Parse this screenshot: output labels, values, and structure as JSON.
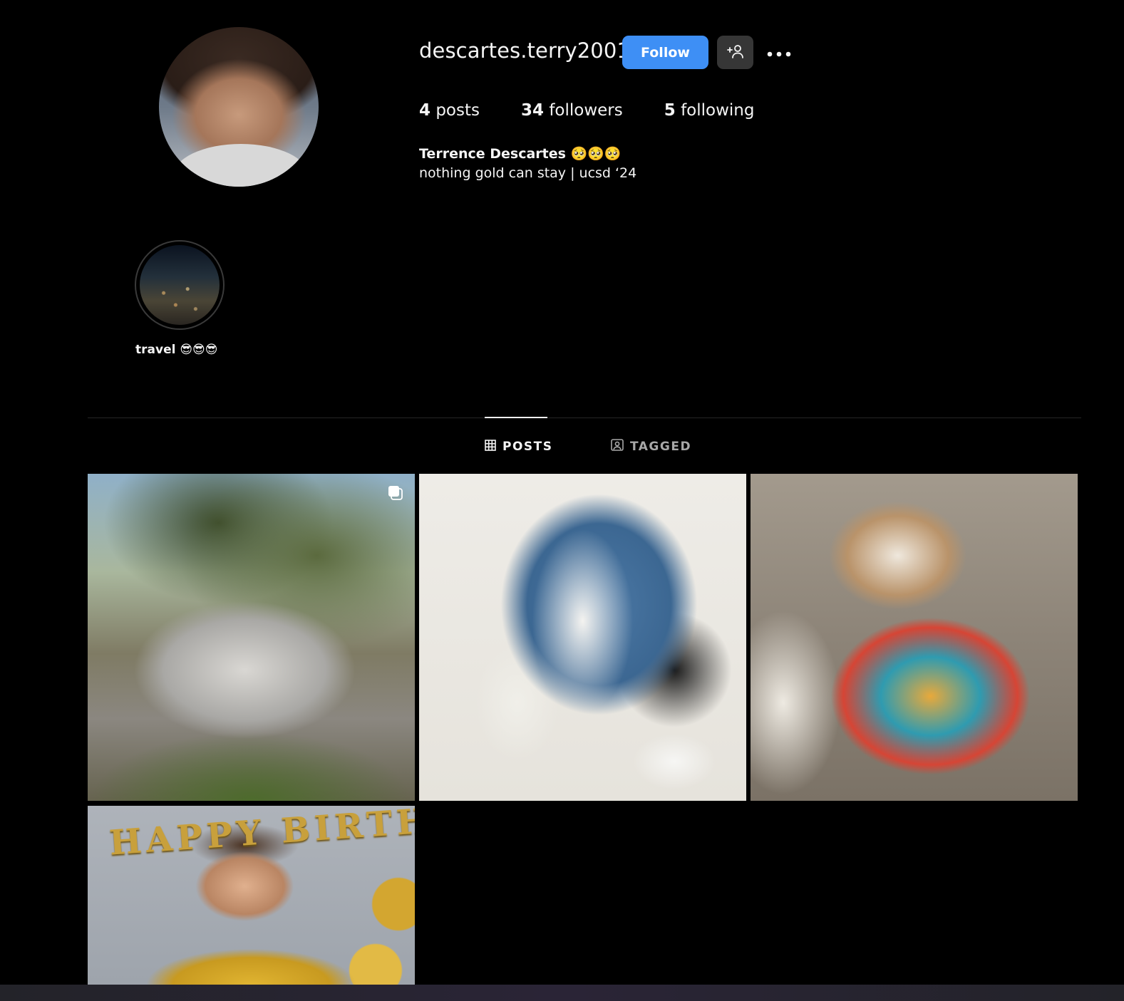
{
  "profile": {
    "username": "descartes.terry2001",
    "follow_label": "Follow",
    "full_name": "Terrence Descartes 🥺🥺🥺",
    "bio": "nothing gold can stay | ucsd ‘24"
  },
  "stats": {
    "posts_count": "4",
    "posts_label": "posts",
    "followers_count": "34",
    "followers_label": "followers",
    "following_count": "5",
    "following_label": "following"
  },
  "highlights": [
    {
      "label": "travel 😎😎😎"
    }
  ],
  "tabs": {
    "posts": "POSTS",
    "tagged": "TAGGED"
  },
  "grid": {
    "items": [
      {
        "subject": "silver car on mountain road",
        "multi": true
      },
      {
        "subject": "denim jacket outfit flat lay",
        "multi": false
      },
      {
        "subject": "small dog in hawaiian shirt",
        "multi": false
      },
      {
        "subject": "birthday portrait",
        "multi": false,
        "banner_text": "HAPPY BIRTHDAY"
      }
    ]
  },
  "colors": {
    "background": "#000000",
    "follow_button": "#3e8ff5",
    "secondary_button": "#363636",
    "tab_inactive": "#a8a8a8"
  },
  "icons": [
    "add-user-icon",
    "more-icon",
    "grid-icon",
    "tagged-icon",
    "multiple-images-icon"
  ]
}
